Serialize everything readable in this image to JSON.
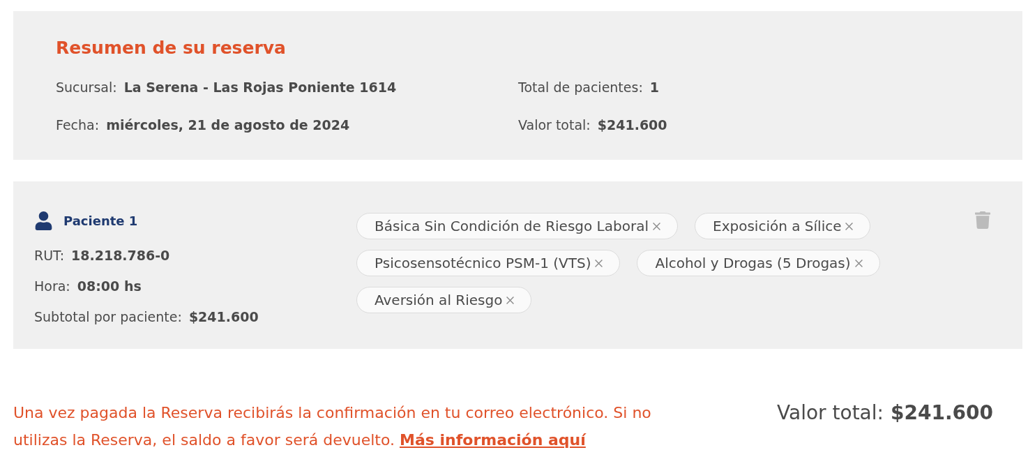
{
  "summary": {
    "title": "Resumen de su reserva",
    "fields": [
      {
        "label": "Sucursal:",
        "value": "La Serena - Las Rojas Poniente 1614"
      },
      {
        "label": "Total de pacientes:",
        "value": "1"
      },
      {
        "label": "Fecha:",
        "value": "miércoles, 21 de agosto de 2024"
      },
      {
        "label": "Valor total:",
        "value": "$241.600"
      }
    ]
  },
  "patients": [
    {
      "title": "Paciente 1",
      "fields": [
        {
          "label": "RUT:",
          "value": "18.218.786-0"
        },
        {
          "label": "Hora:",
          "value": "08:00 hs"
        },
        {
          "label": "Subtotal por paciente:",
          "value": "$241.600"
        }
      ],
      "services": [
        "Básica Sin Condición de Riesgo Laboral",
        "Exposición a Sílice",
        "Psicosensotécnico PSM-1 (VTS)",
        "Alcohol y Drogas (5 Drogas)",
        "Aversión al Riesgo"
      ]
    }
  ],
  "notice": {
    "text": "Una vez pagada la Reserva recibirás la confirmación en tu correo electrónico. Si no utilizas la Reserva, el saldo a favor será devuelto.",
    "link": "Más información aquí"
  },
  "total": {
    "label": "Valor total:",
    "value": "$241.600"
  }
}
